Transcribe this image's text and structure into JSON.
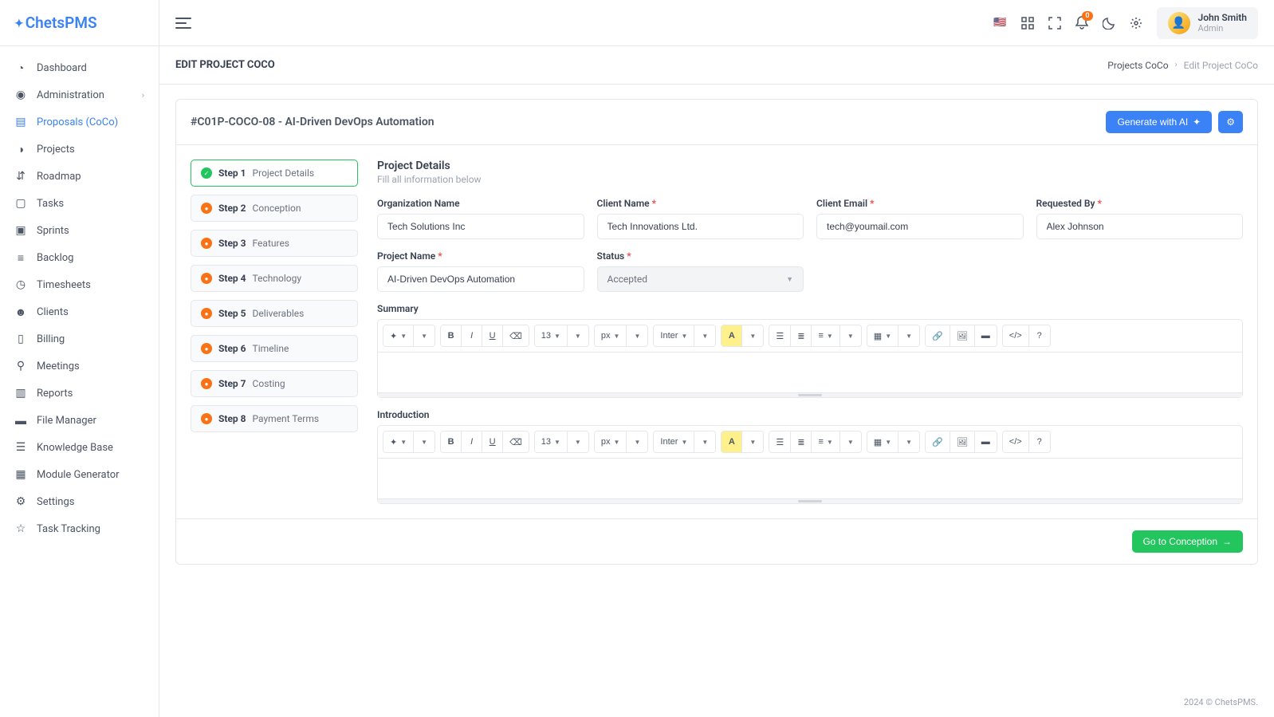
{
  "app": {
    "logo": "ChetsPMS"
  },
  "sidebar": {
    "items": [
      {
        "label": "Dashboard"
      },
      {
        "label": "Administration"
      },
      {
        "label": "Proposals (CoCo)"
      },
      {
        "label": "Projects"
      },
      {
        "label": "Roadmap"
      },
      {
        "label": "Tasks"
      },
      {
        "label": "Sprints"
      },
      {
        "label": "Backlog"
      },
      {
        "label": "Timesheets"
      },
      {
        "label": "Clients"
      },
      {
        "label": "Billing"
      },
      {
        "label": "Meetings"
      },
      {
        "label": "Reports"
      },
      {
        "label": "File Manager"
      },
      {
        "label": "Knowledge Base"
      },
      {
        "label": "Module Generator"
      },
      {
        "label": "Settings"
      },
      {
        "label": "Task Tracking"
      }
    ]
  },
  "topbar": {
    "user_name": "John Smith",
    "user_role": "Admin",
    "notif_count": "0"
  },
  "page": {
    "title": "EDIT PROJECT COCO",
    "breadcrumb_parent": "Projects CoCo",
    "breadcrumb_current": "Edit Project CoCo"
  },
  "card": {
    "title": "#C01P-COCO-08 - AI-Driven DevOps Automation",
    "generate_btn": "Generate with AI",
    "next_btn": "Go to Conception"
  },
  "steps": [
    {
      "num": "Step 1",
      "name": "Project Details"
    },
    {
      "num": "Step 2",
      "name": "Conception"
    },
    {
      "num": "Step 3",
      "name": "Features"
    },
    {
      "num": "Step 4",
      "name": "Technology"
    },
    {
      "num": "Step 5",
      "name": "Deliverables"
    },
    {
      "num": "Step 6",
      "name": "Timeline"
    },
    {
      "num": "Step 7",
      "name": "Costing"
    },
    {
      "num": "Step 8",
      "name": "Payment Terms"
    }
  ],
  "form": {
    "section_title": "Project Details",
    "section_sub": "Fill all information below",
    "org_label": "Organization Name",
    "org_value": "Tech Solutions Inc",
    "client_label": "Client Name",
    "client_value": "Tech Innovations Ltd.",
    "email_label": "Client Email",
    "email_value": "tech@youmail.com",
    "requested_label": "Requested By",
    "requested_value": "Alex Johnson",
    "project_label": "Project Name",
    "project_value": "AI-Driven DevOps Automation",
    "status_label": "Status",
    "status_value": "Accepted",
    "summary_label": "Summary",
    "intro_label": "Introduction"
  },
  "editor_toolbar": {
    "fontsize": "13",
    "unit": "px",
    "font": "Inter"
  },
  "footer": "2024 © ChetsPMS."
}
